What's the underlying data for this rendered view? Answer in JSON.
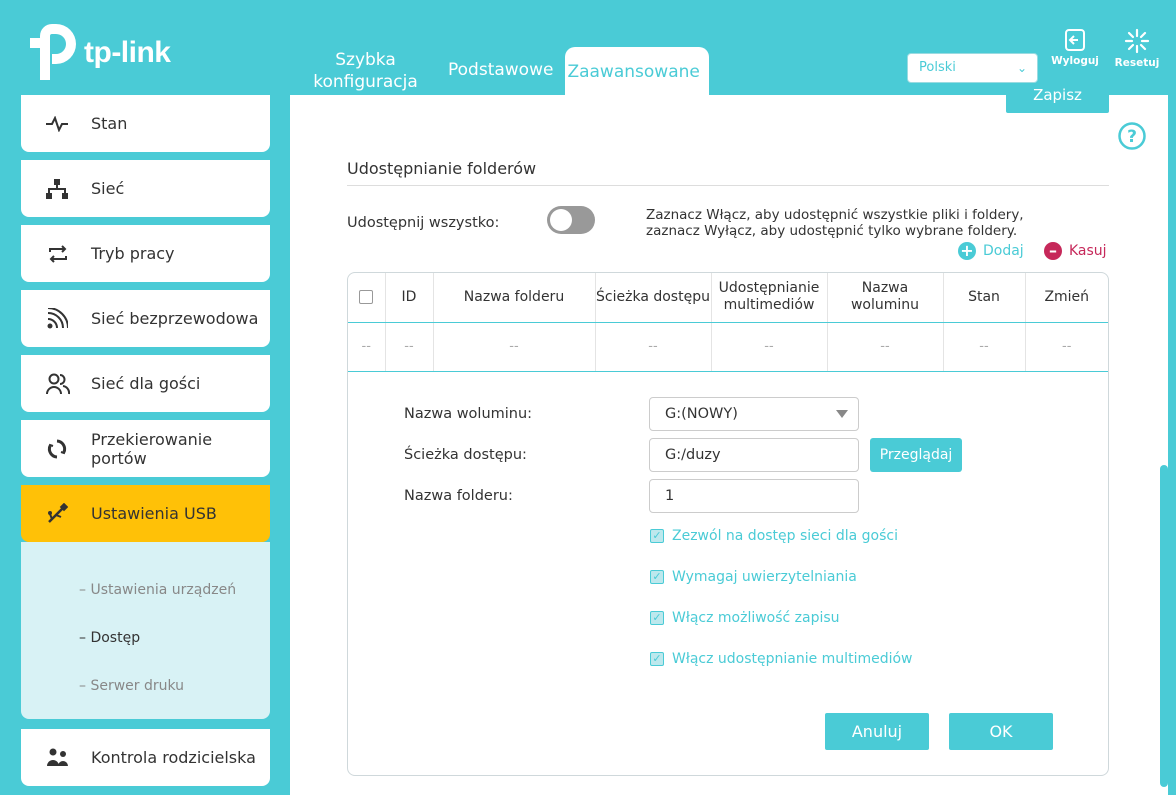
{
  "brand": {
    "name": "tp-link"
  },
  "header": {
    "tabs": [
      {
        "label": "Szybka konfiguracja"
      },
      {
        "label": "Podstawowe"
      },
      {
        "label": "Zaawansowane",
        "active": true
      }
    ],
    "language": {
      "selected": "Polski"
    },
    "logout_label": "Wyloguj",
    "reset_label": "Resetuj"
  },
  "sidebar": {
    "items": [
      {
        "label": "Stan",
        "icon": "pulse-icon"
      },
      {
        "label": "Sieć",
        "icon": "network-icon"
      },
      {
        "label": "Tryb pracy",
        "icon": "repeat-icon"
      },
      {
        "label": "Sieć bezprzewodowa",
        "icon": "wifi-icon"
      },
      {
        "label": "Sieć dla gości",
        "icon": "guests-icon"
      },
      {
        "label": "Przekierowanie portów",
        "icon": "forwarding-icon"
      },
      {
        "label": "Ustawienia USB",
        "icon": "usb-icon",
        "active": true
      },
      {
        "label": "Kontrola rodzicielska",
        "icon": "family-icon"
      }
    ],
    "subitems": [
      {
        "label": "– Ustawienia urządzeń"
      },
      {
        "label": "– Dostęp",
        "current": true
      },
      {
        "label": "– Serwer druku"
      }
    ]
  },
  "main": {
    "save_label": "Zapisz",
    "section_title": "Udostępnianie folderów",
    "share_all_label": "Udostępnij wszystko:",
    "share_all_on": false,
    "hint": "Zaznacz Włącz, aby udostępnić wszystkie pliki i foldery, zaznacz Wyłącz, aby udostępnić tylko wybrane foldery.",
    "add_label": "Dodaj",
    "delete_label": "Kasuj",
    "table": {
      "columns": [
        "",
        "ID",
        "Nazwa folderu",
        "Ścieżka dostępu",
        "Udostępnianie multimediów",
        "Nazwa woluminu",
        "Stan",
        "Zmień"
      ],
      "row": [
        "--",
        "--",
        "--",
        "--",
        "--",
        "--",
        "--",
        "--"
      ]
    },
    "form": {
      "volume_label": "Nazwa woluminu:",
      "volume_value": "G:(NOWY)",
      "path_label": "Ścieżka dostępu:",
      "path_value": "G:/duzy",
      "browse_label": "Przeglądaj",
      "folder_label": "Nazwa folderu:",
      "folder_value": "1",
      "checkboxes": [
        {
          "label": "Zezwól na dostęp sieci dla gości",
          "checked": true
        },
        {
          "label": "Wymagaj uwierzytelniania",
          "checked": true
        },
        {
          "label": "Włącz możliwość zapisu",
          "checked": true
        },
        {
          "label": "Włącz udostępnianie multimediów",
          "checked": true
        }
      ],
      "cancel_label": "Anuluj",
      "ok_label": "OK"
    }
  },
  "colors": {
    "accent": "#4acbd6",
    "active_nav": "#ffc107",
    "delete": "#c6285a"
  }
}
